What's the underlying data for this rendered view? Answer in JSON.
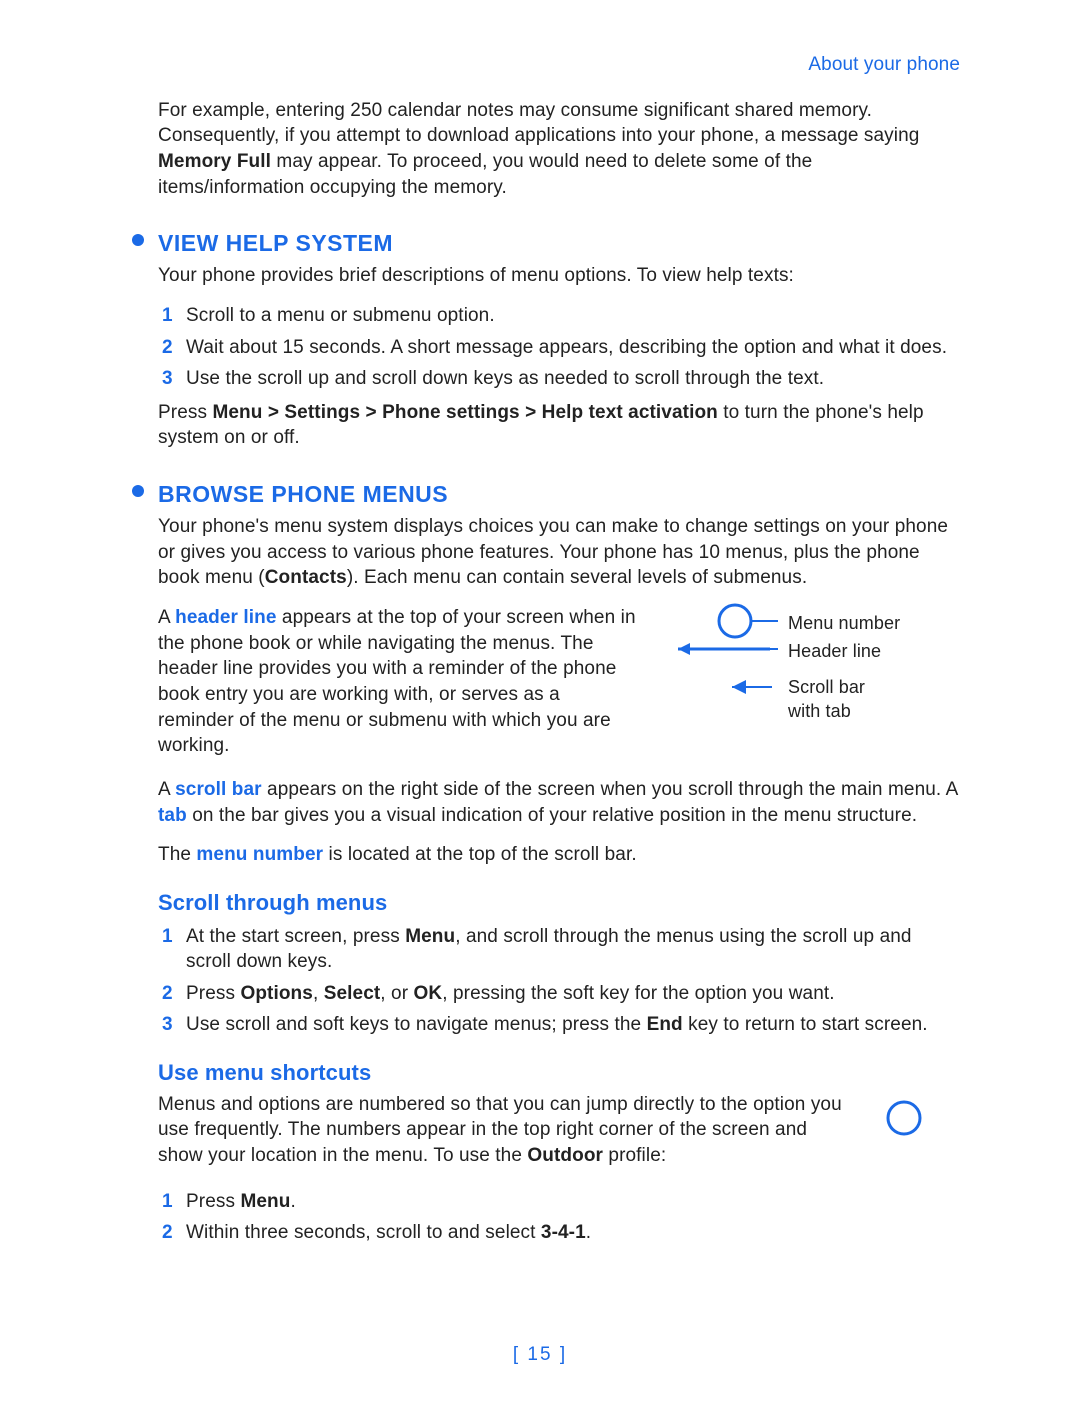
{
  "header": {
    "section_link": "About your phone"
  },
  "intro": {
    "p1a": "For example, entering 250 calendar notes may consume significant shared memory. Consequently, if you attempt to download applications into your phone, a message saying ",
    "p1b": "Memory Full",
    "p1c": " may appear. To proceed, you would need to delete some of the items/information occupying the memory."
  },
  "view_help": {
    "title": "VIEW HELP SYSTEM",
    "intro": "Your phone provides brief descriptions of menu options. To view help texts:",
    "steps": [
      "Scroll to a menu or submenu option.",
      "Wait about 15 seconds. A short message appears, describing the option and what it does.",
      "Use the scroll up and scroll down keys as needed to scroll through the text."
    ],
    "press_a": "Press ",
    "press_b": "Menu > Settings > Phone settings > Help text activation",
    "press_c": " to turn the phone's help system on or off."
  },
  "browse": {
    "title": "BROWSE PHONE MENUS",
    "intro_a": "Your phone's menu system displays choices you can make to change settings on your phone or gives you access to various phone features. Your phone has 10 menus, plus the phone book menu (",
    "intro_b": "Contacts",
    "intro_c": "). Each menu can contain several levels of submenus.",
    "headerline_a": "A ",
    "headerline_term": "header line",
    "headerline_b": " appears at the top of your screen when in the phone book or while navigating the menus. The header line provides you with a reminder of the phone book entry you are working with, or serves as a reminder of the menu or submenu with which you are working.",
    "scrollbar_a": "A ",
    "scrollbar_term": "scroll bar",
    "scrollbar_b": " appears on the right side of the screen when you scroll through the main menu. A ",
    "tab_term": "tab",
    "scrollbar_c": " on the bar gives you a visual indication of your relative position in the menu structure.",
    "menunum_a": "The ",
    "menunum_term": "menu number",
    "menunum_b": " is located at the top of the scroll bar.",
    "callouts": {
      "menu_number": "Menu number",
      "header_line": "Header line",
      "scroll_bar_l1": "Scroll bar",
      "scroll_bar_l2": "with tab"
    }
  },
  "scroll_through": {
    "title": "Scroll through menus",
    "step1_a": "At the start screen, press ",
    "step1_b": "Menu",
    "step1_c": ", and scroll through the menus using the scroll up and scroll down keys.",
    "step2_a": "Press ",
    "step2_b": "Options",
    "step2_c": ", ",
    "step2_d": "Select",
    "step2_e": ", or ",
    "step2_f": "OK",
    "step2_g": ", pressing the soft key for the option you want.",
    "step3_a": "Use scroll and soft keys to navigate menus; press the ",
    "step3_b": "End",
    "step3_c": " key to return to start screen."
  },
  "shortcuts": {
    "title": "Use menu shortcuts",
    "intro_a": "Menus and options are numbered so that you can jump directly to the option you use frequently. The numbers appear in the top right corner of the screen and show your location in the menu. To use the ",
    "intro_b": "Outdoor",
    "intro_c": " profile:",
    "step1_a": "Press ",
    "step1_b": "Menu",
    "step1_c": ".",
    "step2_a": "Within three seconds, scroll to and select ",
    "step2_b": "3-4-1",
    "step2_c": "."
  },
  "footer": {
    "page_label": "[ 15 ]"
  }
}
